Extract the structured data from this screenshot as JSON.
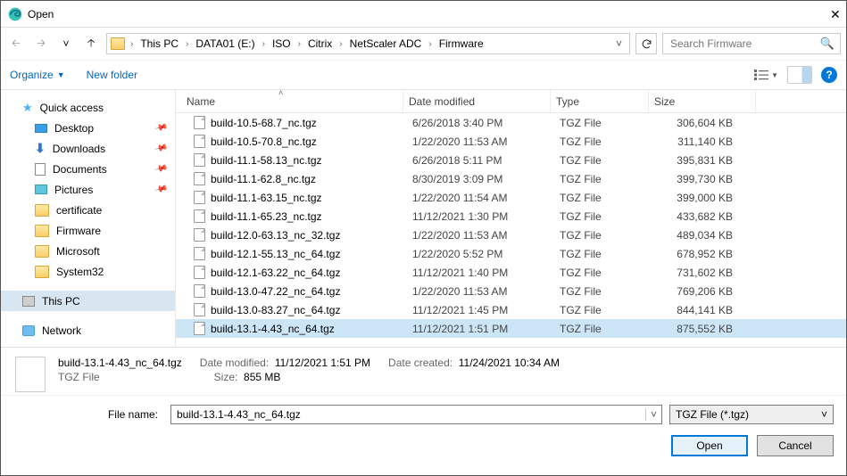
{
  "window": {
    "title": "Open"
  },
  "breadcrumbs": [
    "This PC",
    "DATA01 (E:)",
    "ISO",
    "Citrix",
    "NetScaler ADC",
    "Firmware"
  ],
  "search": {
    "placeholder": "Search Firmware"
  },
  "toolbar": {
    "organize": "Organize",
    "newfolder": "New folder"
  },
  "sidebar": {
    "quick": "Quick access",
    "desktop": "Desktop",
    "downloads": "Downloads",
    "documents": "Documents",
    "pictures": "Pictures",
    "certificate": "certificate",
    "firmware": "Firmware",
    "microsoft": "Microsoft",
    "system32": "System32",
    "thispc": "This PC",
    "network": "Network"
  },
  "columns": {
    "name": "Name",
    "date": "Date modified",
    "type": "Type",
    "size": "Size"
  },
  "files": [
    {
      "name": "build-10.5-68.7_nc.tgz",
      "date": "6/26/2018 3:40 PM",
      "type": "TGZ File",
      "size": "306,604 KB"
    },
    {
      "name": "build-10.5-70.8_nc.tgz",
      "date": "1/22/2020 11:53 AM",
      "type": "TGZ File",
      "size": "311,140 KB"
    },
    {
      "name": "build-11.1-58.13_nc.tgz",
      "date": "6/26/2018 5:11 PM",
      "type": "TGZ File",
      "size": "395,831 KB"
    },
    {
      "name": "build-11.1-62.8_nc.tgz",
      "date": "8/30/2019 3:09 PM",
      "type": "TGZ File",
      "size": "399,730 KB"
    },
    {
      "name": "build-11.1-63.15_nc.tgz",
      "date": "1/22/2020 11:54 AM",
      "type": "TGZ File",
      "size": "399,000 KB"
    },
    {
      "name": "build-11.1-65.23_nc.tgz",
      "date": "11/12/2021 1:30 PM",
      "type": "TGZ File",
      "size": "433,682 KB"
    },
    {
      "name": "build-12.0-63.13_nc_32.tgz",
      "date": "1/22/2020 11:53 AM",
      "type": "TGZ File",
      "size": "489,034 KB"
    },
    {
      "name": "build-12.1-55.13_nc_64.tgz",
      "date": "1/22/2020 5:52 PM",
      "type": "TGZ File",
      "size": "678,952 KB"
    },
    {
      "name": "build-12.1-63.22_nc_64.tgz",
      "date": "11/12/2021 1:40 PM",
      "type": "TGZ File",
      "size": "731,602 KB"
    },
    {
      "name": "build-13.0-47.22_nc_64.tgz",
      "date": "1/22/2020 11:53 AM",
      "type": "TGZ File",
      "size": "769,206 KB"
    },
    {
      "name": "build-13.0-83.27_nc_64.tgz",
      "date": "11/12/2021 1:45 PM",
      "type": "TGZ File",
      "size": "844,141 KB"
    },
    {
      "name": "build-13.1-4.43_nc_64.tgz",
      "date": "11/12/2021 1:51 PM",
      "type": "TGZ File",
      "size": "875,552 KB"
    }
  ],
  "selected_index": 11,
  "details": {
    "filename": "build-13.1-4.43_nc_64.tgz",
    "filetype": "TGZ File",
    "mod_label": "Date modified:",
    "mod_value": "11/12/2021 1:51 PM",
    "size_label": "Size:",
    "size_value": "855 MB",
    "created_label": "Date created:",
    "created_value": "11/24/2021 10:34 AM"
  },
  "footer": {
    "filename_label": "File name:",
    "filename_value": "build-13.1-4.43_nc_64.tgz",
    "filter": "TGZ File (*.tgz)",
    "open": "Open",
    "cancel": "Cancel"
  }
}
